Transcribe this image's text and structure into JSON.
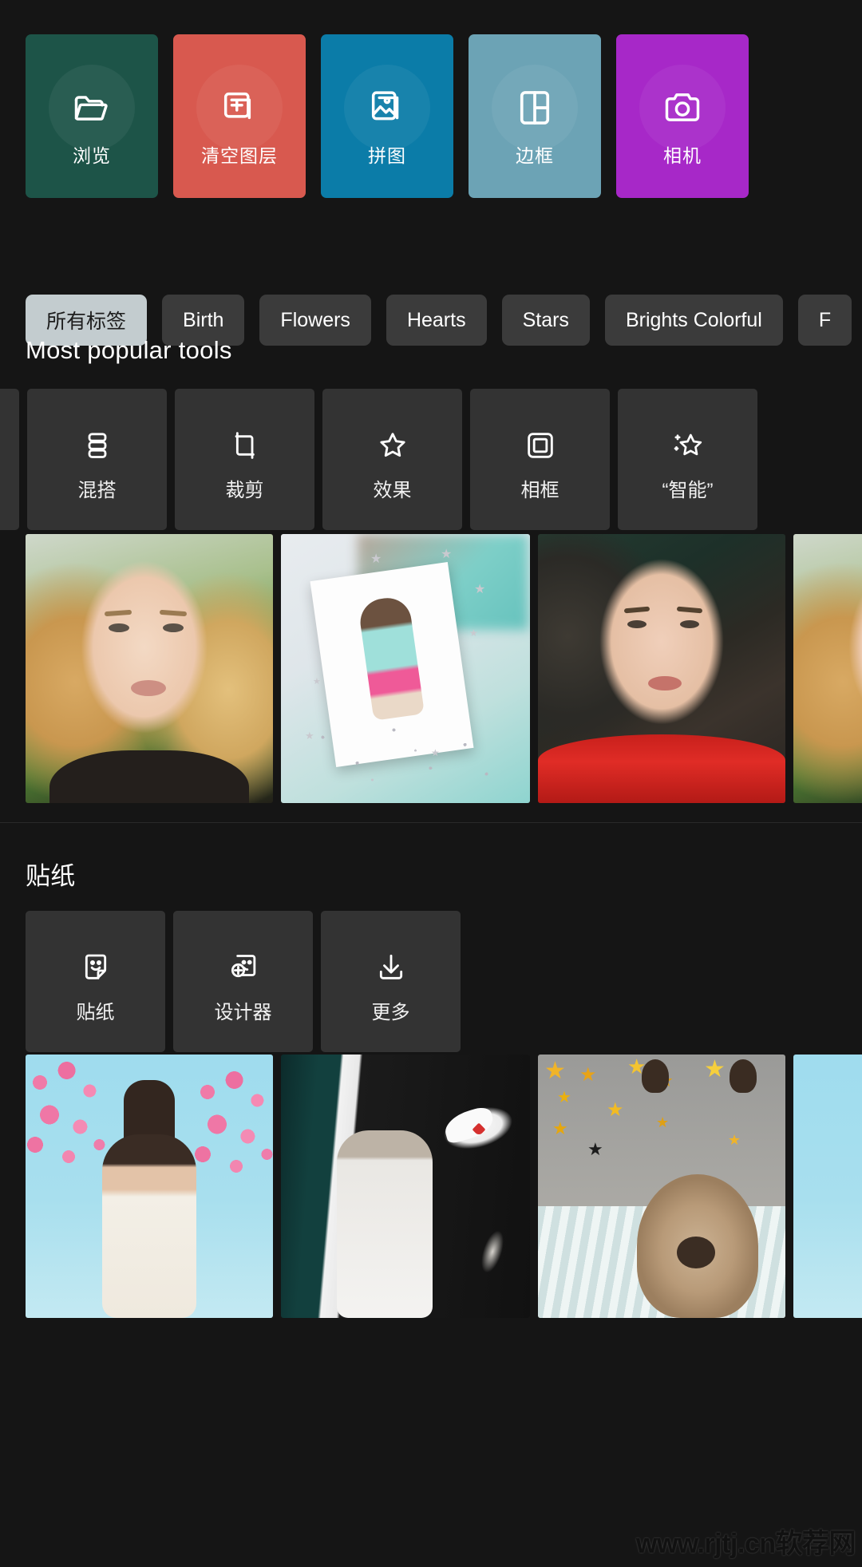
{
  "colors": {
    "page_background": "#151515",
    "card_surface": "#333333",
    "chip_surface": "#3b3b3b",
    "chip_selected_surface": "#c3cccf",
    "divider": "#2a2a2a"
  },
  "hero_cards": [
    {
      "label": "浏览",
      "icon": "folder-open-icon",
      "color": "#1d5448"
    },
    {
      "label": "清空图层",
      "icon": "add-layer-icon",
      "color": "#d8594f"
    },
    {
      "label": "拼图",
      "icon": "image-icon",
      "color": "#0b7ca8"
    },
    {
      "label": "边框",
      "icon": "layout-frame-icon",
      "color": "#6ca3b5"
    },
    {
      "label": "相机",
      "icon": "camera-icon",
      "color": "#a728c8"
    }
  ],
  "tags": [
    {
      "label": "所有标签",
      "selected": true
    },
    {
      "label": "Birth",
      "selected": false
    },
    {
      "label": "Flowers",
      "selected": false
    },
    {
      "label": "Hearts",
      "selected": false
    },
    {
      "label": "Stars",
      "selected": false
    },
    {
      "label": "Brights Colorful",
      "selected": false
    },
    {
      "label": "F",
      "selected": false
    }
  ],
  "sections": {
    "most_popular": {
      "title": "Most popular tools",
      "tools": [
        {
          "label": "混搭",
          "icon": "layers-icon"
        },
        {
          "label": "裁剪",
          "icon": "crop-icon"
        },
        {
          "label": "效果",
          "icon": "star-icon"
        },
        {
          "label": "相框",
          "icon": "frame-icon"
        },
        {
          "label": "“智能”",
          "icon": "magic-star-icon"
        }
      ]
    },
    "stickers": {
      "title": "贴纸",
      "tools": [
        {
          "label": "贴纸",
          "icon": "sticker-smiley-icon"
        },
        {
          "label": "设计器",
          "icon": "sticker-add-icon"
        },
        {
          "label": "更多",
          "icon": "download-icon"
        }
      ]
    }
  },
  "watermark": "www.rjtj.cn软荐网"
}
